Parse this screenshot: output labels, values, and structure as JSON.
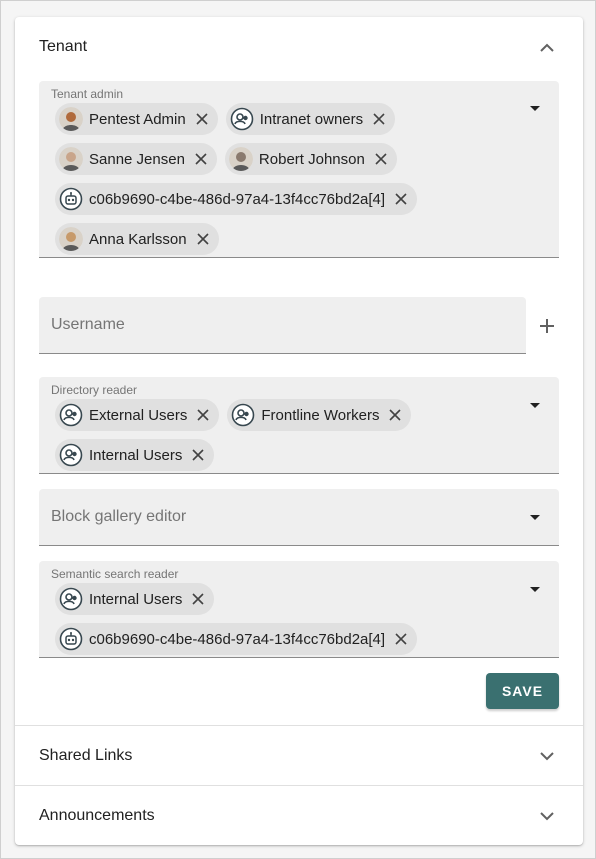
{
  "tenant": {
    "title": "Tenant",
    "tenant_admin": {
      "label": "Tenant admin",
      "chips": [
        {
          "label": "Pentest Admin",
          "type": "person",
          "avatar_color": "#b06a3b"
        },
        {
          "label": "Intranet owners",
          "type": "group"
        },
        {
          "label": "Sanne Jensen",
          "type": "person",
          "avatar_color": "#c9a58a"
        },
        {
          "label": "Robert Johnson",
          "type": "person",
          "avatar_color": "#8a7a6e"
        },
        {
          "label": "c06b9690-c4be-486d-97a4-13f4cc76bd2a[4]",
          "type": "app"
        },
        {
          "label": "Anna Karlsson",
          "type": "person",
          "avatar_color": "#c79a6a"
        }
      ]
    },
    "username": {
      "placeholder": "Username"
    },
    "directory_reader": {
      "label": "Directory reader",
      "chips": [
        {
          "label": "External Users",
          "type": "group"
        },
        {
          "label": "Frontline Workers",
          "type": "group"
        },
        {
          "label": "Internal Users",
          "type": "group"
        }
      ]
    },
    "block_gallery_editor": {
      "placeholder": "Block gallery editor"
    },
    "semantic_search_reader": {
      "label": "Semantic search reader",
      "chips": [
        {
          "label": "Internal Users",
          "type": "group"
        },
        {
          "label": "c06b9690-c4be-486d-97a4-13f4cc76bd2a[4]",
          "type": "app"
        }
      ]
    },
    "save_label": "SAVE"
  },
  "sections": [
    {
      "title": "Shared Links"
    },
    {
      "title": "Announcements"
    }
  ],
  "colors": {
    "accent": "#3a7070",
    "field_bg": "#efefef",
    "chip_bg": "#e0e0e0",
    "icon_dark": "#37474f"
  }
}
